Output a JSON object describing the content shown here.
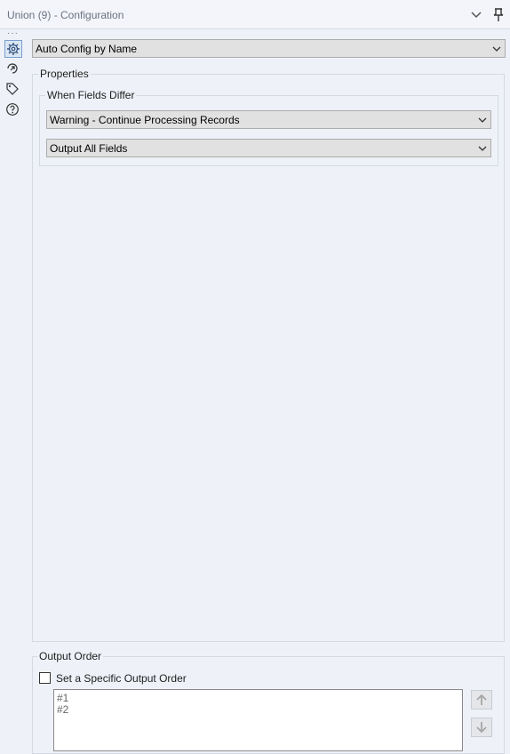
{
  "window": {
    "title": "Union (9) - Configuration"
  },
  "toolbar_icons": [
    "gear-icon",
    "reconnect-icon",
    "tag-icon",
    "help-icon"
  ],
  "mode_select": {
    "value": "Auto Config by Name"
  },
  "properties": {
    "label": "Properties",
    "when_fields_differ": {
      "label": "When Fields Differ",
      "action_select": {
        "value": "Warning - Continue Processing Records"
      },
      "fields_select": {
        "value": "Output All Fields"
      }
    }
  },
  "output_order": {
    "label": "Output Order",
    "checkbox_label": "Set a Specific Output Order",
    "checked": false,
    "items": [
      "#1",
      "#2"
    ]
  },
  "colors": {
    "background": "#eef1f8",
    "active_border": "#7a9fcf"
  }
}
